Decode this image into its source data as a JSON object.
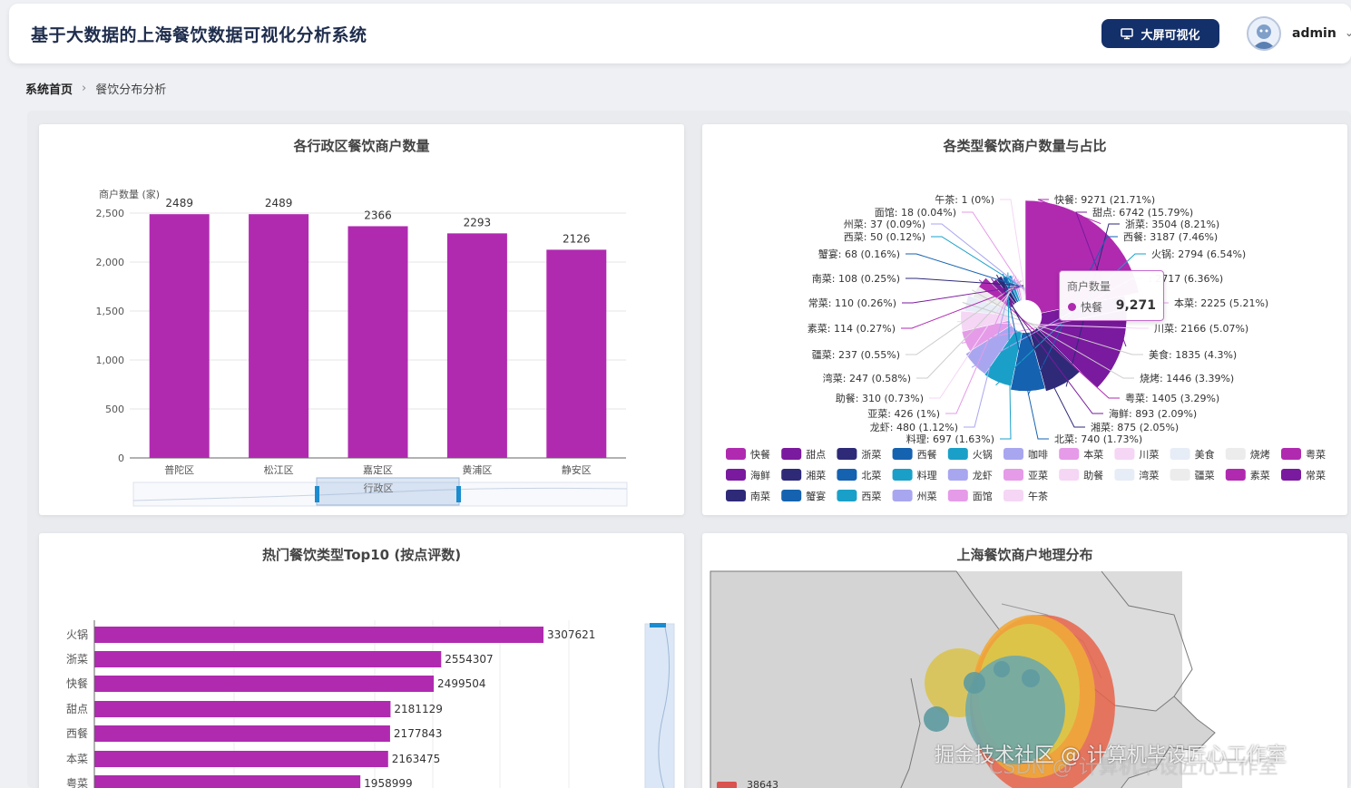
{
  "header": {
    "title": "基于大数据的上海餐饮数据可视化分析系统",
    "bigscreen_label": "大屏可视化",
    "username": "admin"
  },
  "breadcrumb": {
    "home": "系统首页",
    "current": "餐饮分布分析"
  },
  "colors": {
    "accent": "#b02ab0",
    "navy": "#14306b"
  },
  "charts": {
    "district": {
      "title": "各行政区餐饮商户数量",
      "chart_data": {
        "type": "bar",
        "categories": [
          "普陀区",
          "松江区",
          "嘉定区",
          "黄浦区",
          "静安区"
        ],
        "values": [
          2489,
          2489,
          2366,
          2293,
          2126
        ],
        "ylabel": "商户数量 (家)",
        "xlabel": "行政区",
        "ylim": [
          0,
          2500
        ],
        "yticks": [
          "0",
          "500",
          "1,000",
          "1,500",
          "2,000",
          "2,500"
        ],
        "color": "#b02ab0"
      }
    },
    "types": {
      "title": "各类型餐饮商户数量与占比",
      "chart_data": {
        "type": "pie",
        "categories": [
          "快餐",
          "甜点",
          "浙菜",
          "西餐",
          "火锅",
          "咖啡",
          "本菜",
          "川菜",
          "美食",
          "烧烤",
          "粤菜",
          "海鲜",
          "湘菜",
          "北菜",
          "料理",
          "龙虾",
          "亚菜",
          "助餐",
          "湾菜",
          "疆菜",
          "素菜",
          "常菜",
          "南菜",
          "蟹宴",
          "西菜",
          "州菜",
          "面馆",
          "午茶"
        ],
        "values": [
          9271,
          6742,
          3504,
          3187,
          2794,
          2717,
          2225,
          2166,
          1835,
          1446,
          1405,
          893,
          875,
          740,
          697,
          480,
          426,
          310,
          247,
          237,
          114,
          110,
          108,
          68,
          50,
          37,
          18,
          1
        ],
        "labels": [
          "快餐: 9271 (21.71%)",
          "甜点: 6742 (15.79%)",
          "浙菜: 3504 (8.21%)",
          "西餐: 3187 (7.46%)",
          "火锅: 2794 (6.54%)",
          ": 2717 (6.36%)",
          "本菜: 2225 (5.21%)",
          "川菜: 2166 (5.07%)",
          "美食: 1835 (4.3%)",
          "烧烤: 1446 (3.39%)",
          "粤菜: 1405 (3.29%)",
          "海鲜: 893 (2.09%)",
          "湘菜: 875 (2.05%)",
          "北菜: 740 (1.73%)",
          "料理: 697 (1.63%)",
          "龙虾: 480 (1.12%)",
          "亚菜: 426 (1%)",
          "助餐: 310 (0.73%)",
          "湾菜: 247 (0.58%)",
          "疆菜: 237 (0.55%)",
          "素菜: 114 (0.27%)",
          "常菜: 110 (0.26%)",
          "南菜: 108 (0.25%)",
          "蟹宴: 68 (0.16%)",
          "西菜: 50 (0.12%)",
          "州菜: 37 (0.09%)",
          "面馆: 18 (0.04%)",
          "午茶: 1 (0%)"
        ],
        "legend": [
          "快餐",
          "甜点",
          "浙菜",
          "西餐",
          "火锅",
          "咖啡",
          "本菜",
          "川菜",
          "美食",
          "烧烤",
          "粤菜",
          "海鲜",
          "湘菜",
          "北菜",
          "料理",
          "龙虾",
          "亚菜",
          "助餐",
          "湾菜",
          "疆菜",
          "素菜",
          "常菜",
          "南菜",
          "蟹宴",
          "西菜",
          "州菜",
          "面馆",
          "午茶"
        ],
        "colors": [
          "#b02ab0",
          "#7a1a9e",
          "#2e2a78",
          "#1562b0",
          "#1aa0c8",
          "#a9a6f0",
          "#e59be8",
          "#f5d6f5",
          "#e7edf7",
          "#ececec",
          "#b02ab0",
          "#7a1a9e",
          "#2e2a78",
          "#1562b0",
          "#1aa0c8",
          "#a9a6f0",
          "#e59be8",
          "#f5d6f5",
          "#e7edf7",
          "#ececec",
          "#b02ab0",
          "#7a1a9e",
          "#2e2a78",
          "#1562b0",
          "#1aa0c8",
          "#a9a6f0",
          "#e59be8",
          "#f5d6f5"
        ],
        "legend_position": "bottom"
      },
      "tooltip": {
        "title": "商户数量",
        "name": "快餐",
        "value": "9,271"
      }
    },
    "top10": {
      "title": "热门餐饮类型Top10 (按点评数)",
      "chart_data": {
        "type": "bar",
        "orientation": "horizontal",
        "categories": [
          "火锅",
          "浙菜",
          "快餐",
          "甜点",
          "西餐",
          "本菜",
          "粤菜"
        ],
        "values": [
          3307621,
          2554307,
          2499504,
          2181129,
          2177843,
          2163475,
          1958999
        ],
        "color": "#b02ab0"
      }
    },
    "map": {
      "title": "上海餐饮商户地理分布",
      "legend_value": "38643"
    }
  },
  "watermark": "掘金技术社区 @ 计算机毕设匠心工作室",
  "watermark2": "CSDN @ 计算机毕设匠心工作室"
}
